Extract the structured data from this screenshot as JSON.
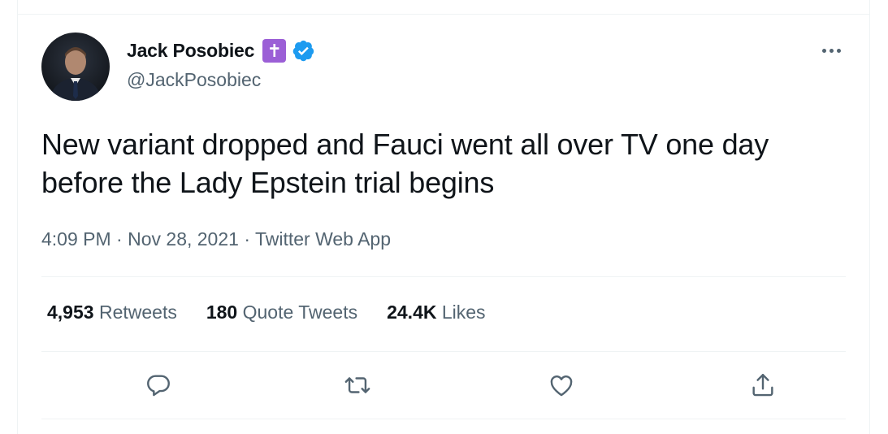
{
  "user": {
    "display_name": "Jack Posobiec",
    "badge_glyph": "✝",
    "handle": "@JackPosobiec",
    "verified": true
  },
  "tweet": {
    "text": "New variant dropped and Fauci went all over TV one day before the Lady Epstein trial begins",
    "time": "4:09 PM",
    "separator": "·",
    "date": "Nov 28, 2021",
    "source": "Twitter Web App"
  },
  "stats": {
    "retweets_count": "4,953",
    "retweets_label": "Retweets",
    "quotes_count": "180",
    "quotes_label": "Quote Tweets",
    "likes_count": "24.4K",
    "likes_label": "Likes"
  },
  "actions": [
    "reply-icon",
    "retweet-icon",
    "like-icon",
    "share-icon"
  ],
  "colors": {
    "text": "#0f1419",
    "secondary": "#536471",
    "verified": "#1d9bf0",
    "badge": "#9b5fd6",
    "divider": "#eff3f4"
  }
}
